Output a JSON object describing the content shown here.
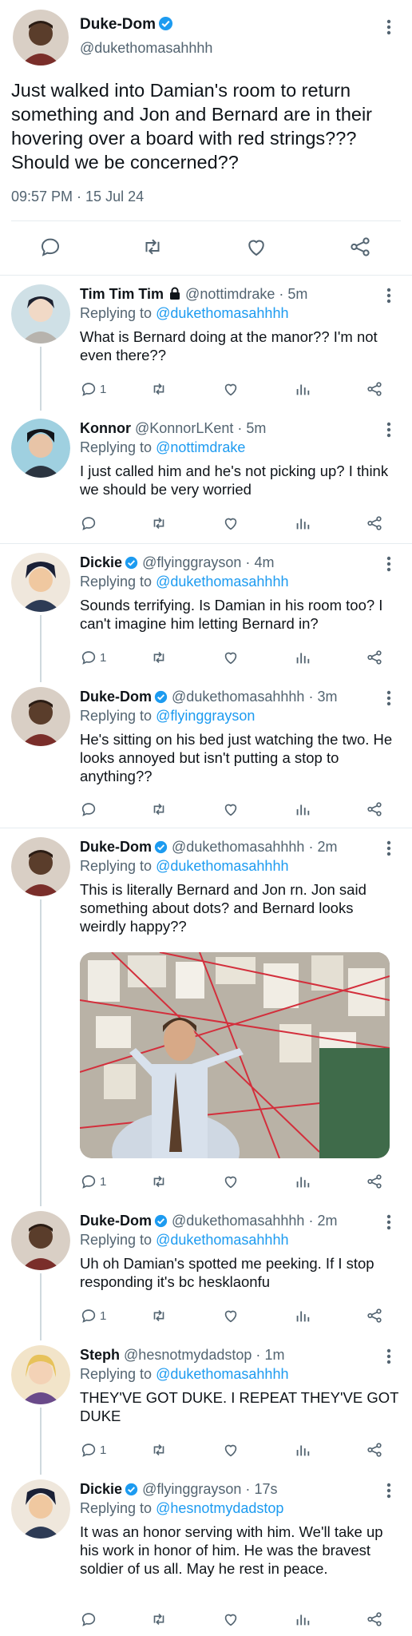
{
  "main": {
    "name": "Duke-Dom",
    "handle": "@dukethomasahhhh",
    "text": "Just walked into Damian's room to return something and Jon and Bernard are in their hovering over a board with red strings??? Should we be concerned??",
    "timestamp": "09:57 PM · 15 Jul 24"
  },
  "replies": [
    {
      "name": "Tim Tim Tim",
      "handle": "@nottimdrake",
      "time": "5m",
      "replying_label": "Replying to",
      "replying_to": "@dukethomasahhhh",
      "text": "What is Bernard doing at the manor?? I'm not even there??",
      "reply_count": "1"
    },
    {
      "name": "Konnor",
      "handle": "@KonnorLKent",
      "time": "5m",
      "replying_label": "Replying to",
      "replying_to": "@nottimdrake",
      "text": "I just called him and he's not picking up? I think we should be very worried",
      "reply_count": ""
    },
    {
      "name": "Dickie",
      "handle": "@flyinggrayson",
      "time": "4m",
      "replying_label": "Replying to",
      "replying_to": "@dukethomasahhhh",
      "text": "Sounds terrifying. Is Damian in his room too? I can't imagine him letting Bernard in?",
      "reply_count": "1"
    },
    {
      "name": "Duke-Dom",
      "handle": "@dukethomasahhhh",
      "time": "3m",
      "replying_label": "Replying to",
      "replying_to": "@flyinggrayson",
      "text": "He's sitting on his bed just watching the two. He looks annoyed but isn't putting a stop to anything??",
      "reply_count": ""
    },
    {
      "name": "Duke-Dom",
      "handle": "@dukethomasahhhh",
      "time": "2m",
      "replying_label": "Replying to",
      "replying_to": "@dukethomasahhhh",
      "text": "This is literally Bernard and Jon rn. Jon said something about dots? and Bernard looks weirdly happy??",
      "reply_count": "1"
    },
    {
      "name": "Duke-Dom",
      "handle": "@dukethomasahhhh",
      "time": "2m",
      "replying_label": "Replying to",
      "replying_to": "@dukethomasahhhh",
      "text": "Uh oh Damian's spotted me peeking. If I stop responding it's bc hesklaonfu",
      "reply_count": "1"
    },
    {
      "name": "Steph",
      "handle": "@hesnotmydadstop",
      "time": "1m",
      "replying_label": "Replying to",
      "replying_to": "@dukethomasahhhh",
      "text": "THEY'VE GOT DUKE. I REPEAT THEY'VE GOT DUKE",
      "reply_count": "1"
    },
    {
      "name": "Dickie",
      "handle": "@flyinggrayson",
      "time": "17s",
      "replying_label": "Replying to",
      "replying_to": "@hesnotmydadstop",
      "text": "It was an honor serving with him. We'll take up his work in honor of him. He was the bravest soldier of us all. May he rest in peace.",
      "reply_count": ""
    }
  ],
  "separator": "·",
  "colors": {
    "accent": "#1d9bf0",
    "text": "#0f1419",
    "muted": "#536471",
    "divider": "#e6ecf0"
  }
}
